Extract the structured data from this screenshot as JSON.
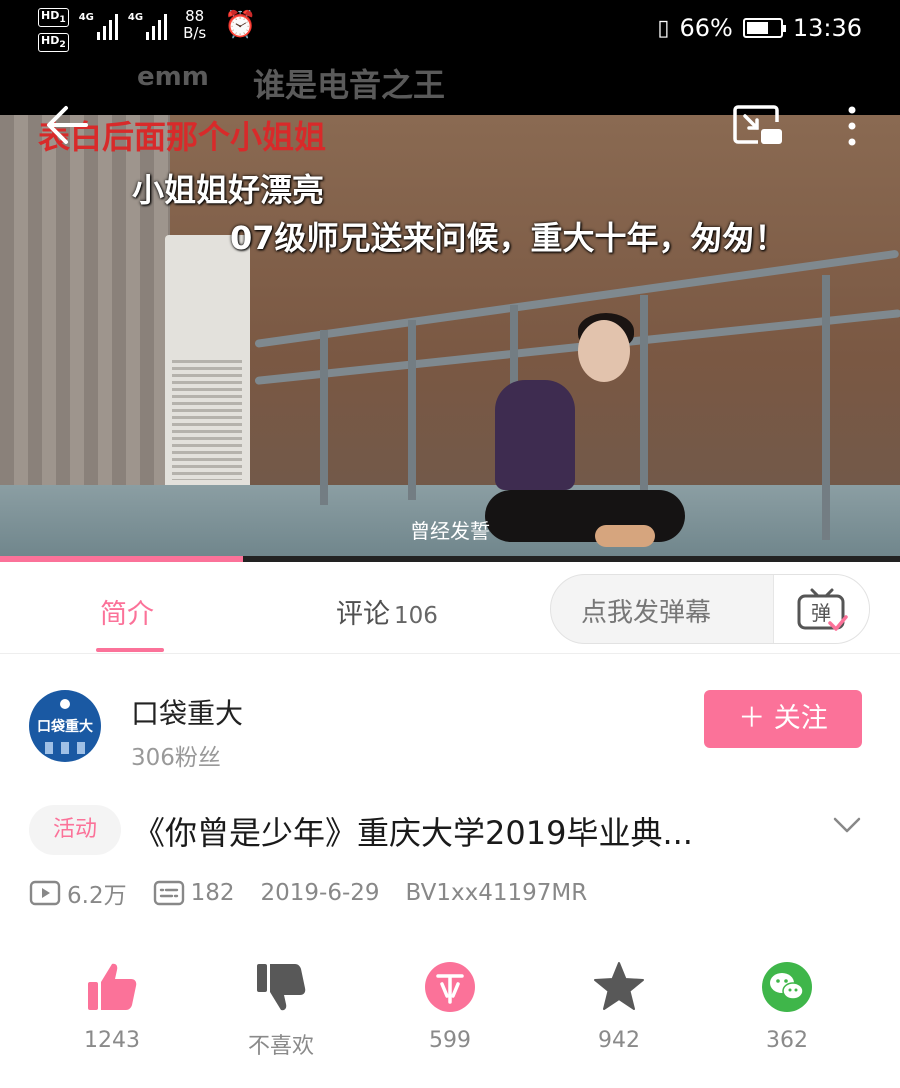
{
  "status_bar": {
    "hd1": "HD",
    "hd1_sub": "1",
    "hd2": "HD",
    "hd2_sub": "2",
    "net1": "4G",
    "net2": "4G",
    "speed_value": "88",
    "speed_unit": "B/s",
    "battery": "66%",
    "time": "13:36",
    "battery_level": 0.66
  },
  "video": {
    "danmaku": [
      "emm",
      "谁是电音之王",
      "表白后面那个小姐姐",
      "小姐姐好漂亮",
      "07级师兄送来问候，重大十年，匆匆！"
    ],
    "subtitle": "曾经发誓",
    "progress": 0.27
  },
  "tabs": {
    "intro": "简介",
    "comments": "评论",
    "comments_count": "106"
  },
  "danmaku_input": {
    "placeholder": "点我发弹幕",
    "button_glyph": "弹"
  },
  "uploader": {
    "avatar_text": "口袋重大",
    "name": "口袋重大",
    "fans": "306粉丝",
    "follow_label": "＋ 关注"
  },
  "video_info": {
    "tag": "活动",
    "title": "《你曾是少年》重庆大学2019毕业典...",
    "views": "6.2万",
    "danmaku_count": "182",
    "date": "2019-6-29",
    "bvid": "BV1xx41197MR"
  },
  "actions": {
    "like": "1243",
    "dislike": "不喜欢",
    "coin": "599",
    "favorite": "942",
    "share": "362"
  },
  "colors": {
    "accent": "#fb7299",
    "wechat": "#3fb64a",
    "icon_grey": "#585858"
  },
  "icons": [
    "back-icon",
    "cast-icon",
    "more-icon",
    "tv-icon",
    "chevron-down-icon",
    "play-count-icon",
    "danmaku-count-icon",
    "thumbs-up-icon",
    "thumbs-down-icon",
    "coin-icon",
    "star-icon",
    "wechat-icon",
    "alarm-icon",
    "battery-icon"
  ]
}
